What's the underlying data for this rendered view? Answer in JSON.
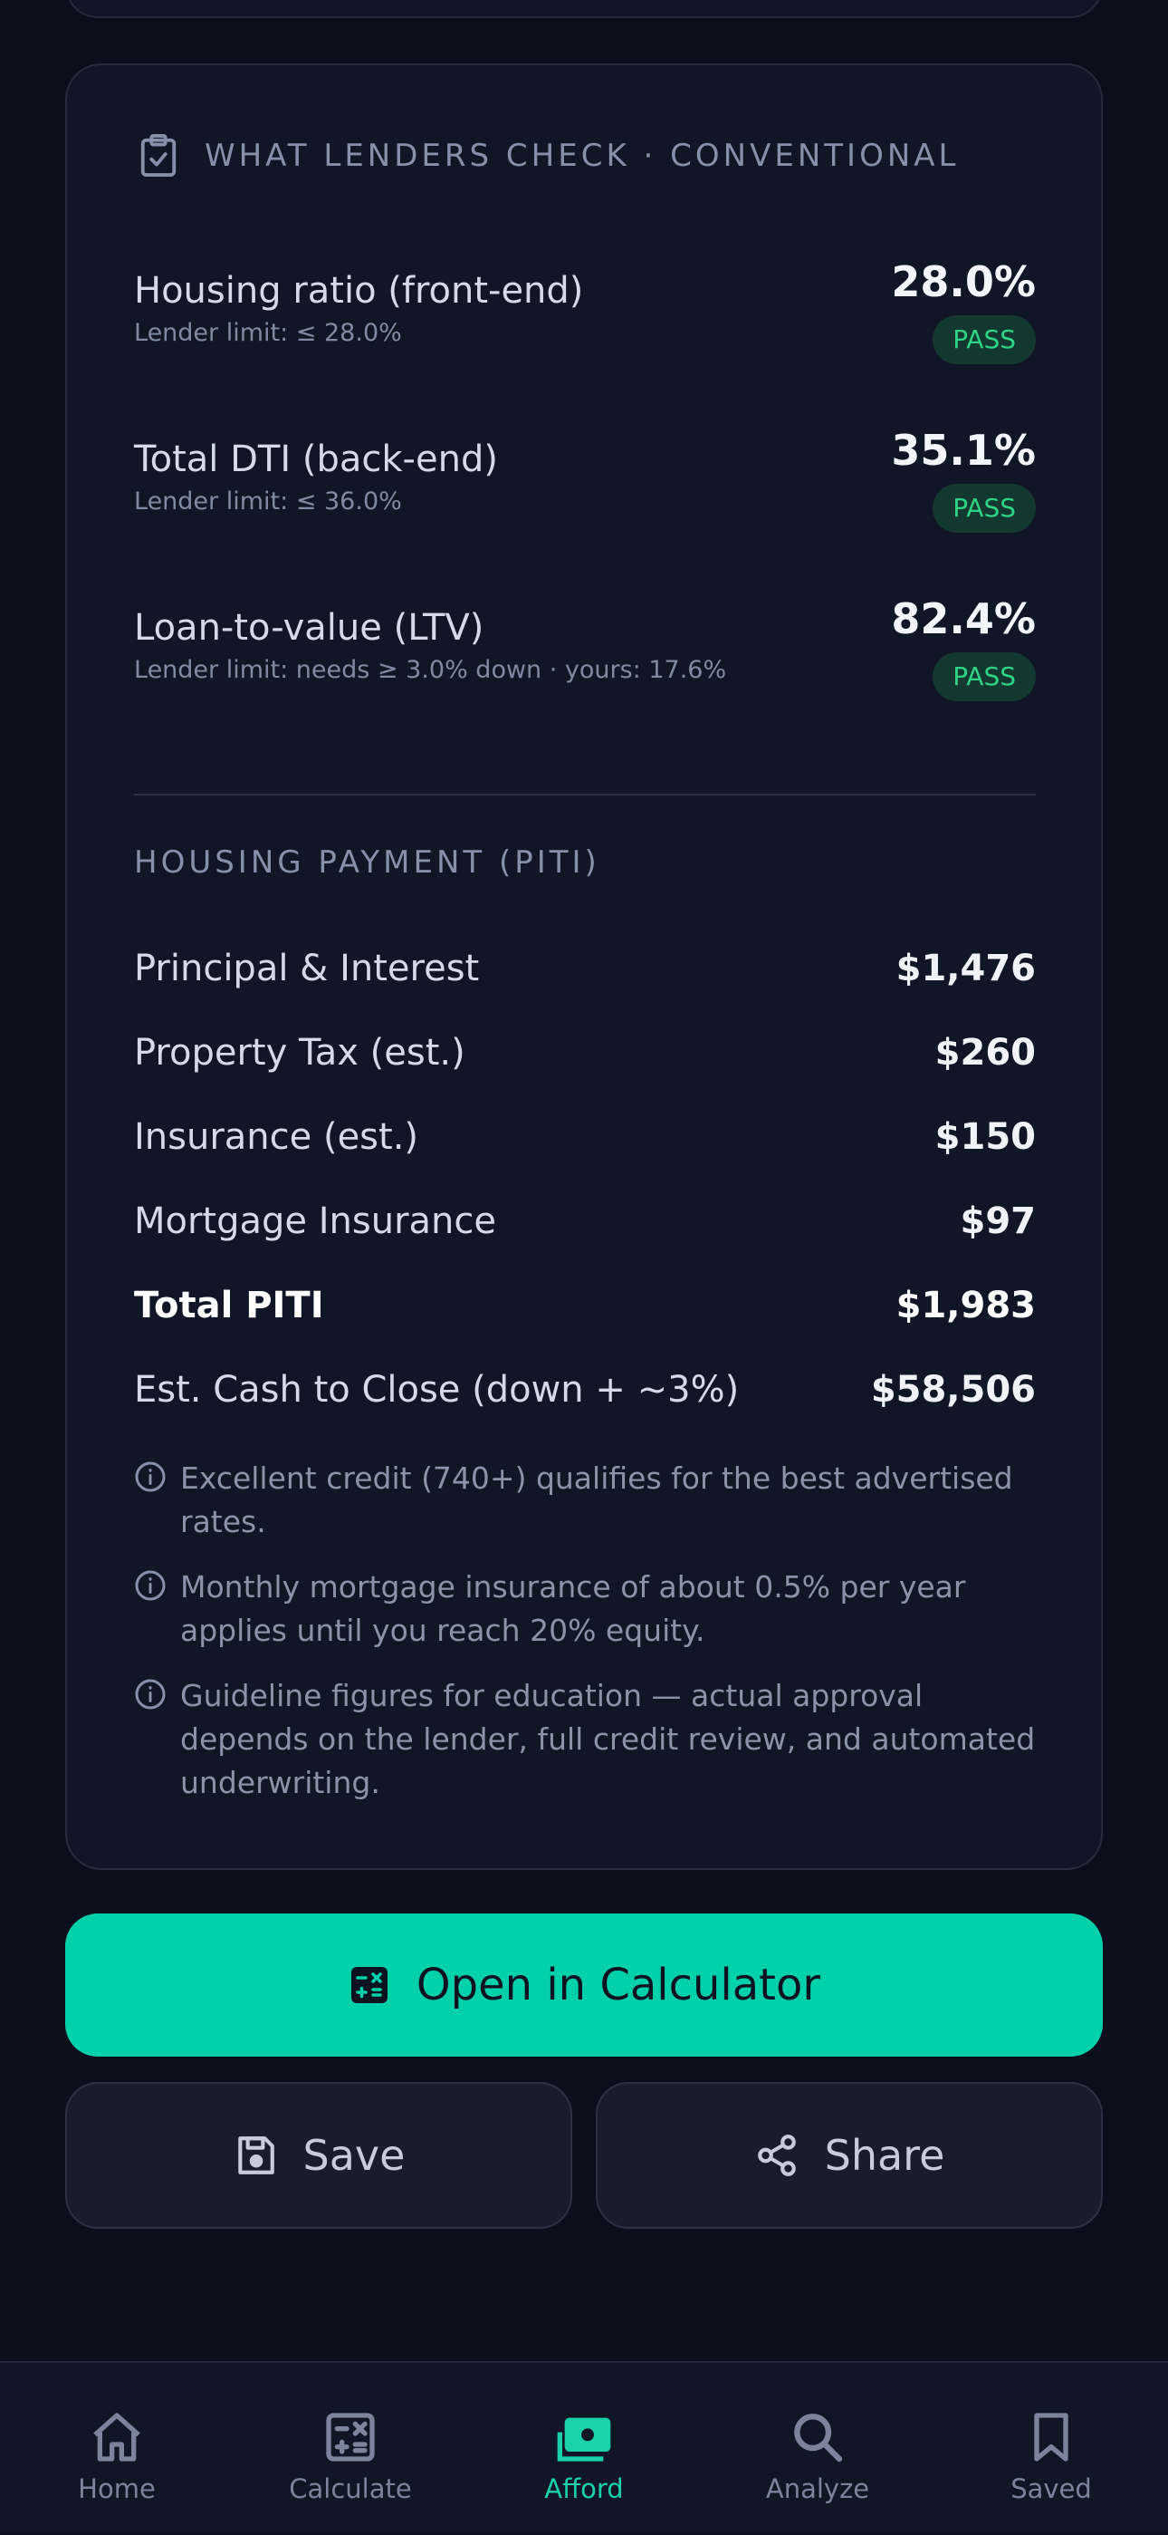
{
  "lenders_check": {
    "title": "WHAT LENDERS CHECK · CONVENTIONAL",
    "checks": [
      {
        "label": "Housing ratio (front-end)",
        "sub": "Lender limit: ≤ 28.0%",
        "value": "28.0%",
        "status": "PASS"
      },
      {
        "label": "Total DTI (back-end)",
        "sub": "Lender limit: ≤ 36.0%",
        "value": "35.1%",
        "status": "PASS"
      },
      {
        "label": "Loan-to-value (LTV)",
        "sub": "Lender limit: needs ≥ 3.0% down · yours: 17.6%",
        "value": "82.4%",
        "status": "PASS"
      }
    ]
  },
  "piti": {
    "title": "HOUSING PAYMENT (PITI)",
    "rows": [
      {
        "label": "Principal & Interest",
        "value": "$1,476"
      },
      {
        "label": "Property Tax (est.)",
        "value": "$260"
      },
      {
        "label": "Insurance (est.)",
        "value": "$150"
      },
      {
        "label": "Mortgage Insurance",
        "value": "$97"
      },
      {
        "label": "Total PITI",
        "value": "$1,983"
      },
      {
        "label": "Est. Cash to Close (down + ~3%)",
        "value": "$58,506"
      }
    ]
  },
  "notes": [
    "Excellent credit (740+) qualifies for the best advertised rates.",
    "Monthly mortgage insurance of about 0.5% per year applies until you reach 20% equity.",
    "Guideline figures for education — actual approval depends on the lender, full credit review, and automated underwriting."
  ],
  "actions": {
    "open_calculator": "Open in Calculator",
    "save": "Save",
    "share": "Share"
  },
  "tabbar": {
    "active": "Afford",
    "items": [
      {
        "label": "Home",
        "icon": "home-icon"
      },
      {
        "label": "Calculate",
        "icon": "calculator-icon"
      },
      {
        "label": "Afford",
        "icon": "cash-icon"
      },
      {
        "label": "Analyze",
        "icon": "search-icon"
      },
      {
        "label": "Saved",
        "icon": "bookmark-icon"
      }
    ]
  },
  "colors": {
    "background": "#0b0f1c",
    "card": "#111626",
    "accent": "#00d1ab",
    "pass_text": "#2ed388",
    "pass_bg": "#12382f"
  }
}
